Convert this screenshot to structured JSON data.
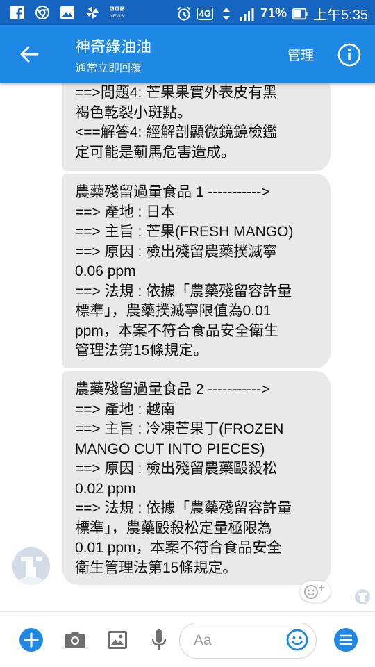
{
  "status_bar": {
    "network_type": "4G",
    "battery": "71%",
    "time": "上午5:35",
    "left_icons": [
      "facebook-icon",
      "chrome-icon",
      "gallery-icon",
      "pinwheel-icon",
      "bbc-news-icon"
    ],
    "right_icons": [
      "alarm-icon",
      "signal-icon",
      "battery-icon"
    ]
  },
  "header": {
    "title": "神奇綠油油",
    "subtitle": "通常立即回覆",
    "manage_label": "管理",
    "colors": {
      "header_bg": "#1e88e5",
      "status_bg": "#1565c0"
    }
  },
  "messages": [
    {
      "lines": [
        "==>問題4: 芒果果實外表皮有黑",
        "褐色乾裂小斑點。",
        "<==解答4: 經解剖顯微鏡鏡檢鑑",
        "定可能是薊馬危害造成。"
      ]
    },
    {
      "lines": [
        "農藥殘留過量食品 1 ----------->",
        "==> 產地 : 日本",
        "==> 主旨 : 芒果(FRESH MANGO)",
        "==> 原因 : 檢出殘留農藥撲滅寧",
        "0.06 ppm",
        "==> 法規 : 依據「農藥殘留容許量",
        "標準」，農藥撲滅寧限值為0.01",
        "ppm，本案不符合食品安全衛生",
        "管理法第15條規定。"
      ]
    },
    {
      "lines": [
        "農藥殘留過量食品 2 ----------->",
        "==> 產地 : 越南",
        "==> 主旨 : 冷凍芒果丁(FROZEN",
        "MANGO CUT INTO PIECES)",
        "==> 原因 : 檢出殘留農藥毆殺松",
        "0.02 ppm",
        "==> 法規 : 依據「農藥殘留容許量",
        "標準」，農藥毆殺松定量極限為",
        "0.01 ppm，本案不符合食品安全",
        "衛生管理法第15條規定。"
      ]
    }
  ],
  "composer": {
    "placeholder": "Aa",
    "accent_color": "#1e88e5"
  }
}
